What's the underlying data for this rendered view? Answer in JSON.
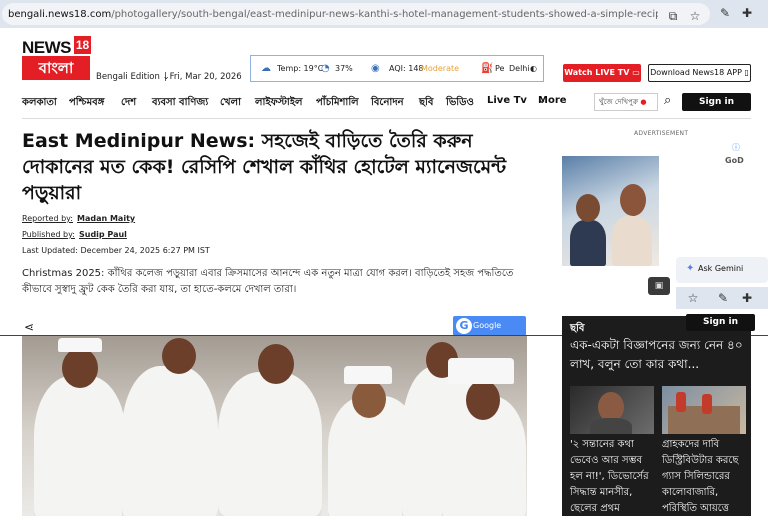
{
  "browser": {
    "url_host": "bengali.news18.com",
    "url_path": "/photogallery/south-bengal/east-medinipur-news-kanthi-s-hotel-management-students-showed-a-simple-recipe-for-making-cakes-at-home-on-..."
  },
  "header": {
    "logo_news": "NEWS",
    "logo_num": "18",
    "logo_lang": "বাংলা",
    "edition": "Bengali Edition",
    "date": "Fri, Mar 20, 2026",
    "weather": {
      "temp": "Temp: 19°C",
      "humidity": "37%",
      "aqi": "AQI: 148",
      "aqi_status": "Moderate",
      "aqi_color": "#e8a13b",
      "pe": "Pe",
      "city": "Delhi"
    },
    "watch_live": "Watch LIVE TV",
    "download": "Download News18 APP"
  },
  "nav": {
    "items": [
      "কলকাতা",
      "পশ্চিমবঙ্গ",
      "দেশ",
      "ব্যবসা বাণিজ্য",
      "খেলা",
      "লাইফস্টাইল",
      "পাঁচমিশালি",
      "বিনোদন",
      "ছবি",
      "ভিডিও",
      "Live Tv",
      "More"
    ],
    "search_placeholder": "খুঁজে দেখিপুরু",
    "sign_in": "Sign in"
  },
  "article": {
    "headline": "East Medinipur News: সহজেই বাড়িতে তৈরি করুন দোকানের মত কেক! রেসিপি শেখাল কাঁথির হোটেল ম্যানেজমেন্ট পড়ুয়ারা",
    "reported_label": "Reported by:",
    "reported_by": "Madan Maity",
    "published_label": "Published by:",
    "published_by": "Sudip Paul",
    "last_updated": "Last Updated: December 24, 2025 6:27 PM IST",
    "summary": "Christmas 2025: কাঁথির কলেজ পড়ুয়ারা এবার ক্রিসমাসের আনন্দে এক নতুন মাত্রা যোগ করল। বাড়িতেই সহজ পদ্ধতিতে কীভাবে সুস্বাদু ফ্রুট কেক তৈরি করা যায়, তা হাতে-কলমে দেখাল তারা।",
    "google_btn": "Google"
  },
  "sidebar": {
    "ad_label": "ADVERTISEMENT",
    "ad_brand": "GoD",
    "gemini": "Ask Gemini",
    "sign_in": "Sign in",
    "section_head": "ছবি",
    "promo_title": "এক-একটা বিজ্ঞাপনের জন্য নেন ৪০ লাখ, বলুন তো কার কথা...",
    "cards": [
      {
        "caption": "'২ সন্তানের কথা ভেবেও আর সম্ভব হল না!', ডিভোর্সের সিদ্ধান্ত মানসীর, ছেলের প্রথম"
      },
      {
        "caption": "গ্রাহকদের দাবি ডিস্ট্রিবিউটার করছে গ্যাস সিলিন্ডারের কালোবাজারি, পরিস্থিতি আয়ত্তে"
      }
    ]
  }
}
